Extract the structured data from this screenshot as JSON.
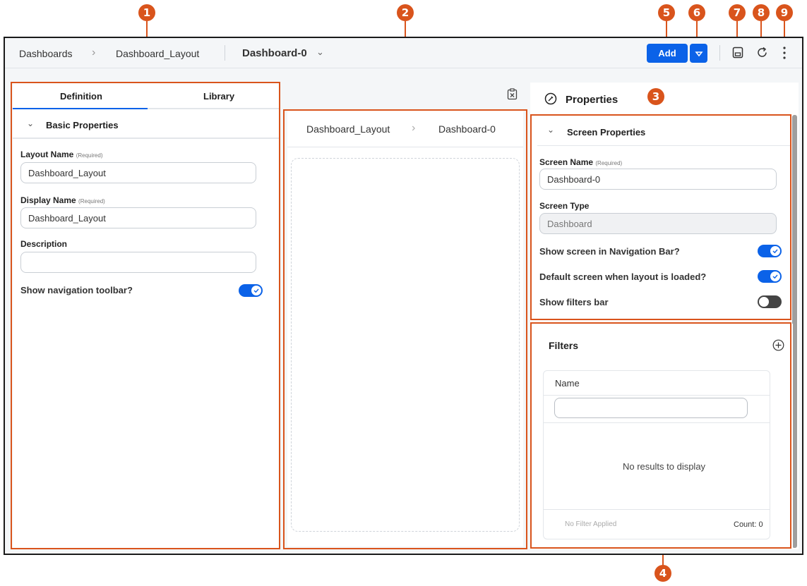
{
  "callouts": [
    "1",
    "2",
    "3",
    "4",
    "5",
    "6",
    "7",
    "8",
    "9"
  ],
  "header": {
    "crumb1": "Dashboards",
    "crumb2": "Dashboard_Layout",
    "current": "Dashboard-0",
    "add_label": "Add"
  },
  "left_panel": {
    "tabs": [
      "Definition",
      "Library"
    ],
    "section_title": "Basic Properties",
    "layout_name_label": "Layout Name",
    "layout_name_req": "(Required)",
    "layout_name_value": "Dashboard_Layout",
    "display_name_label": "Display Name",
    "display_name_req": "(Required)",
    "display_name_value": "Dashboard_Layout",
    "description_label": "Description",
    "description_value": "",
    "toolbar_toggle_label": "Show navigation toolbar?",
    "toolbar_toggle_on": true
  },
  "canvas": {
    "crumb1": "Dashboard_Layout",
    "crumb2": "Dashboard-0"
  },
  "properties": {
    "title": "Properties",
    "section_title": "Screen Properties",
    "screen_name_label": "Screen Name",
    "screen_name_req": "(Required)",
    "screen_name_value": "Dashboard-0",
    "screen_type_label": "Screen Type",
    "screen_type_value": "Dashboard",
    "toggles": [
      {
        "label": "Show screen in Navigation Bar?",
        "on": true
      },
      {
        "label": "Default screen when layout is loaded?",
        "on": true
      },
      {
        "label": "Show filters bar",
        "on": false
      }
    ]
  },
  "filters": {
    "title": "Filters",
    "column_name": "Name",
    "empty_text": "No results to display",
    "footer_status": "No Filter Applied",
    "footer_count": "Count: 0"
  },
  "colors": {
    "accent": "#0b62e8",
    "callout": "#d9541c"
  }
}
